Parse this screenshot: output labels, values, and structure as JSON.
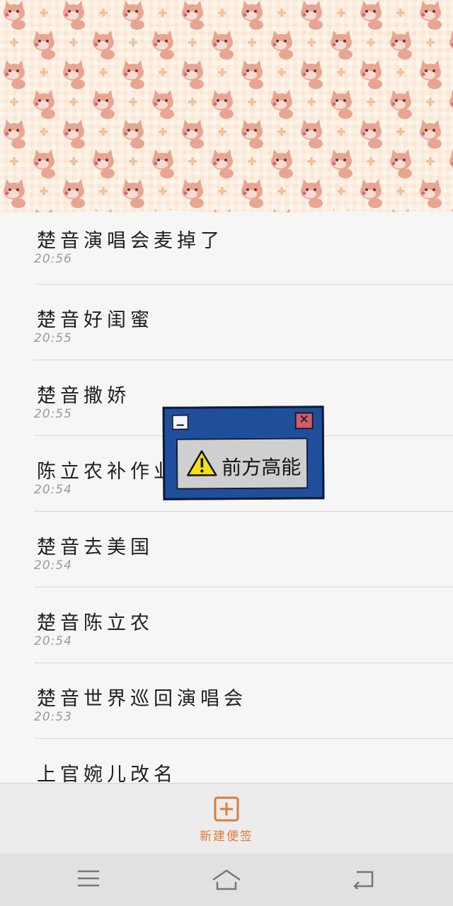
{
  "notes": [
    {
      "title": "楚音演唱会麦掉了",
      "time": "20:56"
    },
    {
      "title": "楚音好闺蜜",
      "time": "20:55"
    },
    {
      "title": "楚音撒娇",
      "time": "20:55"
    },
    {
      "title": "陈立农补作业",
      "time": "20:54"
    },
    {
      "title": "楚音去美国",
      "time": "20:54"
    },
    {
      "title": "楚音陈立农",
      "time": "20:54"
    },
    {
      "title": "楚音世界巡回演唱会",
      "time": "20:53"
    },
    {
      "title": "上官婉儿改名",
      "time": ""
    }
  ],
  "popup": {
    "text": "前方高能",
    "close_glyph": "✕",
    "frame_color": "#1f4f9a"
  },
  "action_bar": {
    "new_note_label": "新建便签",
    "accent_color": "#e07a3c"
  },
  "icons": {
    "new_note": "plus-square-icon",
    "menu": "menu-icon",
    "home": "home-icon",
    "back": "back-icon",
    "warning": "warning-icon"
  }
}
